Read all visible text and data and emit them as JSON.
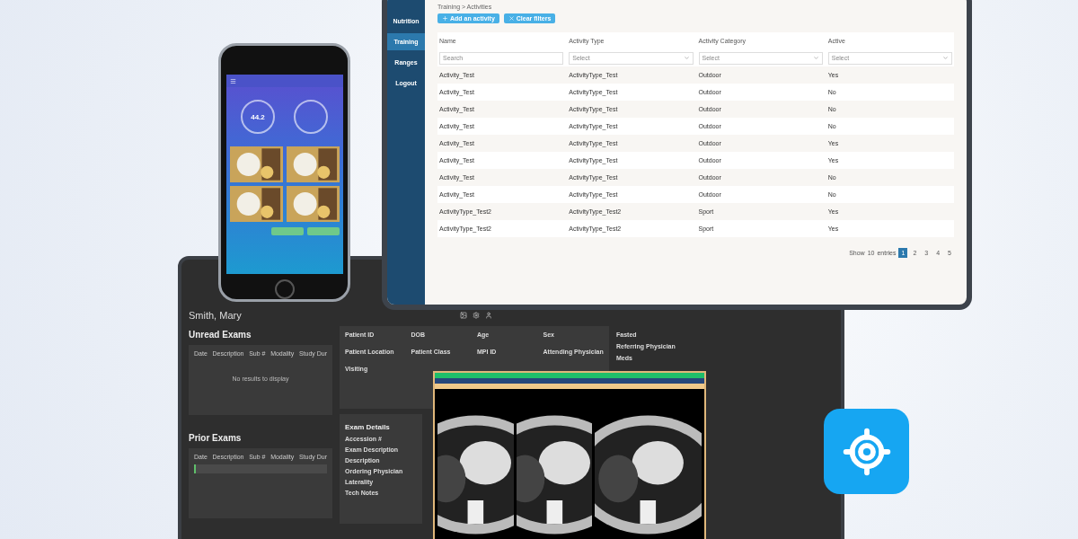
{
  "tablet": {
    "sidebar": [
      {
        "label": "Nutrition",
        "selected": false
      },
      {
        "label": "Training",
        "selected": true
      },
      {
        "label": "Ranges",
        "selected": false
      },
      {
        "label": "Logout",
        "selected": false
      }
    ],
    "breadcrumb": "Training > Activities",
    "buttons": [
      "Add an activity",
      "Clear filters"
    ],
    "columns": [
      "Name",
      "Activity Type",
      "Activity Category",
      "Active"
    ],
    "filters": [
      {
        "kind": "input",
        "placeholder": "Search"
      },
      {
        "kind": "select",
        "value": "Select"
      },
      {
        "kind": "select",
        "value": "Select"
      },
      {
        "kind": "select",
        "value": "Select"
      }
    ],
    "rows": [
      [
        "Activity_Test",
        "ActivityType_Test",
        "Outdoor",
        "Yes"
      ],
      [
        "Activity_Test",
        "ActivityType_Test",
        "Outdoor",
        "No"
      ],
      [
        "Activity_Test",
        "ActivityType_Test",
        "Outdoor",
        "No"
      ],
      [
        "Activity_Test",
        "ActivityType_Test",
        "Outdoor",
        "No"
      ],
      [
        "Activity_Test",
        "ActivityType_Test",
        "Outdoor",
        "Yes"
      ],
      [
        "Activity_Test",
        "ActivityType_Test",
        "Outdoor",
        "Yes"
      ],
      [
        "Activity_Test",
        "ActivityType_Test",
        "Outdoor",
        "No"
      ],
      [
        "Activity_Test",
        "ActivityType_Test",
        "Outdoor",
        "No"
      ],
      [
        "ActivityType_Test2",
        "ActivityType_Test2",
        "Sport",
        "Yes"
      ],
      [
        "ActivityType_Test2",
        "ActivityType_Test2",
        "Sport",
        "Yes"
      ]
    ],
    "pagination": {
      "show": "Show",
      "count": "10",
      "entries": "entries",
      "pages": [
        {
          "label": "1",
          "selected": true
        },
        {
          "label": "2",
          "selected": false
        },
        {
          "label": "3",
          "selected": false
        },
        {
          "label": "4",
          "selected": false
        },
        {
          "label": "5",
          "selected": false
        }
      ]
    }
  },
  "phone": {
    "reading": "44.2"
  },
  "monitor": {
    "patient": "Smith, Mary",
    "unread_exams": {
      "title": "Unread Exams",
      "columns": [
        "Date",
        "Description",
        "Sub #",
        "Modality",
        "Study Dur"
      ],
      "empty": "No results to display"
    },
    "prior_exams": {
      "title": "Prior Exams",
      "columns": [
        "Date",
        "Description",
        "Sub #",
        "Modality",
        "Study Dur"
      ]
    },
    "patient_fields": [
      "Patient ID",
      "DOB",
      "Age",
      "Sex",
      "Patient Location",
      "Patient Class",
      "MPI ID",
      "Attending Physician",
      "Visiting"
    ],
    "exam_details": {
      "title": "Exam Details",
      "fields": [
        "Accession #",
        "Exam Description",
        "Description",
        "Ordering Physician",
        "Laterality",
        "Tech Notes"
      ]
    },
    "side_fields": [
      "Fasted",
      "Referring Physician",
      "Meds"
    ]
  }
}
